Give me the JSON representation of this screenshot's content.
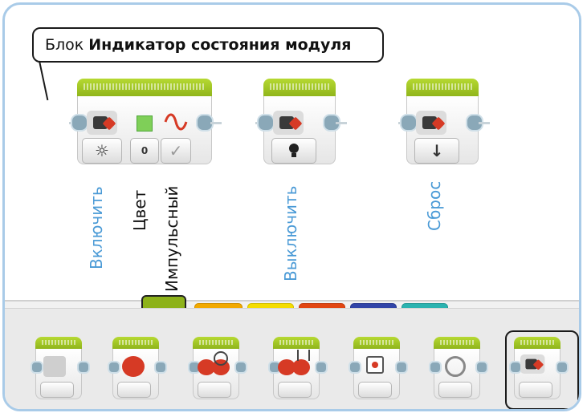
{
  "title": {
    "prefix": "Блок",
    "bold": "Индикатор состояния модуля"
  },
  "modes": {
    "on": "Включить",
    "off": "Выключить",
    "reset": "Сброс"
  },
  "parameters": {
    "color": "Цвет",
    "pulse": "Импульсный",
    "color_value": "0"
  },
  "icons": {
    "on_button": "☼",
    "pulse_check": "✓",
    "off_button": "bulb-icon",
    "reset_button": "↓"
  },
  "palette_tab_colors": [
    "#8db21a",
    "#f2a900",
    "#f5dd00",
    "#e24612",
    "#3245a8",
    "#2bb3b0"
  ],
  "colors": {
    "block_green": "#8db21a",
    "label_blue": "#4a9ad6",
    "frame_blue": "#a9cbe8",
    "brick_red": "#d63a25"
  },
  "palette_blocks": [
    "medium-motor-block",
    "large-motor-block",
    "move-steering-block",
    "move-tank-block",
    "display-block",
    "sound-block",
    "brick-status-light-block"
  ]
}
